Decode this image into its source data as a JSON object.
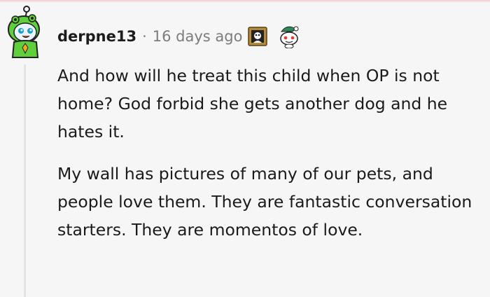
{
  "comment": {
    "username": "derpne13",
    "separator": "·",
    "timestamp": "16 days ago",
    "awards": [
      "framed-portrait-award-icon",
      "snoo-with-hat-award-icon"
    ],
    "paragraphs": [
      "And how will he treat this child when OP is not home? God forbid she gets another dog and he hates it.",
      "My wall has pictures of many of our pets, and people love them. They are fantastic conversation starters. They are momentos of love."
    ]
  },
  "colors": {
    "background": "#f6f6f6",
    "text": "#1a1a1b",
    "meta_text": "#7c7c7c",
    "thread_line": "#e3e3e3",
    "avatar_green": "#5fcf3b"
  }
}
